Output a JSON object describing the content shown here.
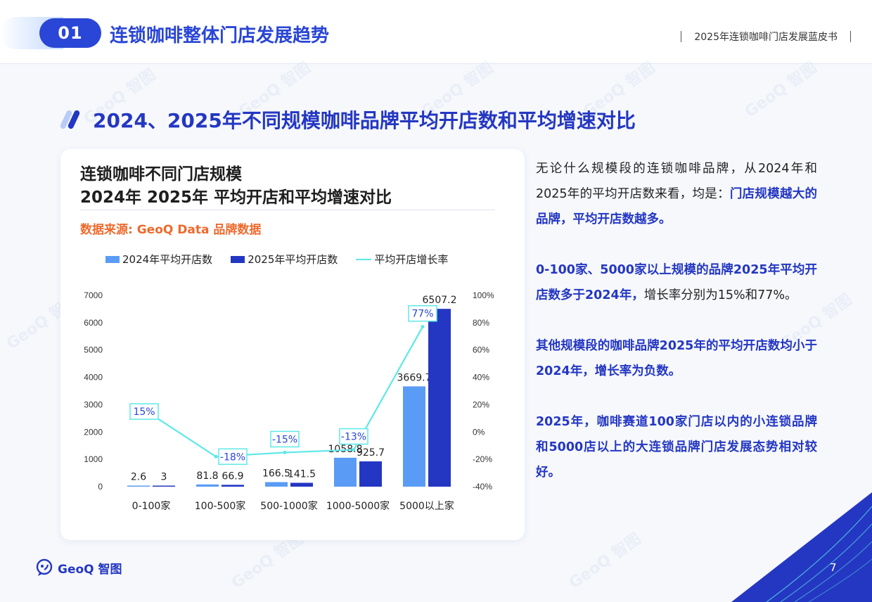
{
  "header": {
    "section_number": "01",
    "section_title": "连锁咖啡整体门店发展趋势",
    "report_name": "2025年连锁咖啡门店发展蓝皮书"
  },
  "page_title": "2024、2025年不同规模咖啡品牌平均开店数和平均增速对比",
  "chart_card": {
    "title_line1": "连锁咖啡不同门店规模",
    "title_line2": "2024年 2025年 平均开店和平均增速对比",
    "source": "数据来源: GeoQ Data 品牌数据"
  },
  "chart_data": {
    "type": "bar",
    "categories": [
      "0-100家",
      "100-500家",
      "500-1000家",
      "1000-5000家",
      "5000以上家"
    ],
    "series": [
      {
        "name": "2024年平均开店数",
        "type": "bar",
        "axis": "left",
        "values": [
          2.6,
          81.8,
          166.5,
          1058.8,
          3669.7
        ],
        "labels": [
          "2.6",
          "81.8",
          "166.5",
          "1058.8",
          "3669.7"
        ]
      },
      {
        "name": "2025年平均开店数",
        "type": "bar",
        "axis": "left",
        "values": [
          3,
          66.9,
          141.5,
          925.7,
          6507.2
        ],
        "labels": [
          "3",
          "66.9",
          "141.5",
          "925.7",
          "6507.2"
        ]
      },
      {
        "name": "平均开店增长率",
        "type": "line",
        "axis": "right",
        "values": [
          15,
          -18,
          -15,
          -13,
          77
        ],
        "labels": [
          "15%",
          "-18%",
          "-15%",
          "-13%",
          "77%"
        ]
      }
    ],
    "left_axis": {
      "min": 0,
      "max": 7000,
      "ticks": [
        "0",
        "1000",
        "2000",
        "3000",
        "4000",
        "5000",
        "6000",
        "7000"
      ]
    },
    "right_axis": {
      "min": -40,
      "max": 100,
      "ticks": [
        "-40%",
        "-20%",
        "0%",
        "20%",
        "40%",
        "60%",
        "80%",
        "100%"
      ]
    },
    "legend_position": "top",
    "grid": false,
    "colors": {
      "bar2024": "#5a9cf5",
      "bar2025": "#2437c2",
      "line": "#5ee8e8"
    }
  },
  "right_text": {
    "p1_normal": "无论什么规模段的连锁咖啡品牌，从2024年和2025年的平均开店数来看，均是：",
    "p1_highlight": "门店规模越大的品牌，平均开店数越多。",
    "p2_highlight": "0-100家、5000家以上规模的品牌2025年平均开店数多于2024年，",
    "p2_normal": "增长率分别为15%和77%。",
    "p3": "其他规模段的咖啡品牌2025年的平均开店数均小于2024年，增长率为负数。",
    "p4": "2025年，咖啡赛道100家门店以内的小连锁品牌和5000店以上的大连锁品牌门店发展态势相对较好。"
  },
  "footer": {
    "logo_text": "GeoQ 智图",
    "page_number": "7"
  },
  "colors": {
    "brand_blue": "#2437c2",
    "accent_orange": "#ee6a2d"
  }
}
